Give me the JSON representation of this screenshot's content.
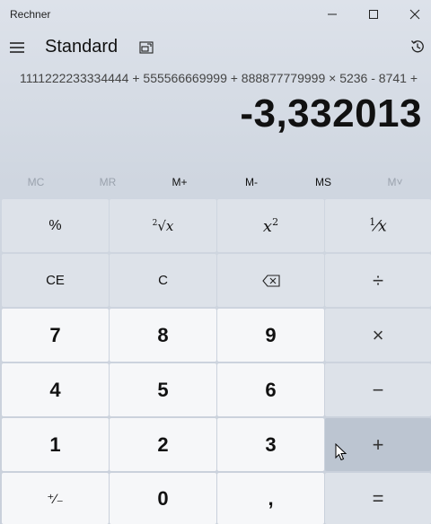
{
  "window": {
    "title": "Rechner"
  },
  "header": {
    "mode": "Standard"
  },
  "display": {
    "expression": "1111222233334444 + 555566669999 + 888877779999 × 5236 - 8741 +",
    "result": "-3,332013"
  },
  "memory": {
    "mc": "MC",
    "mr": "MR",
    "mplus": "M+",
    "mminus": "M-",
    "ms": "MS",
    "mlist": "M˅"
  },
  "keys": {
    "percent": "%",
    "sqrt_root_index": "2",
    "sqrt_x": "x",
    "square_base": "x",
    "square_exp": "2",
    "recip_num": "1",
    "recip_den": "x",
    "ce": "CE",
    "c": "C",
    "divide": "÷",
    "seven": "7",
    "eight": "8",
    "nine": "9",
    "multiply": "×",
    "four": "4",
    "five": "5",
    "six": "6",
    "minus": "−",
    "one": "1",
    "two": "2",
    "three": "3",
    "plus": "+",
    "negate": "⁺∕₋",
    "zero": "0",
    "decimal": ",",
    "equals": "="
  }
}
